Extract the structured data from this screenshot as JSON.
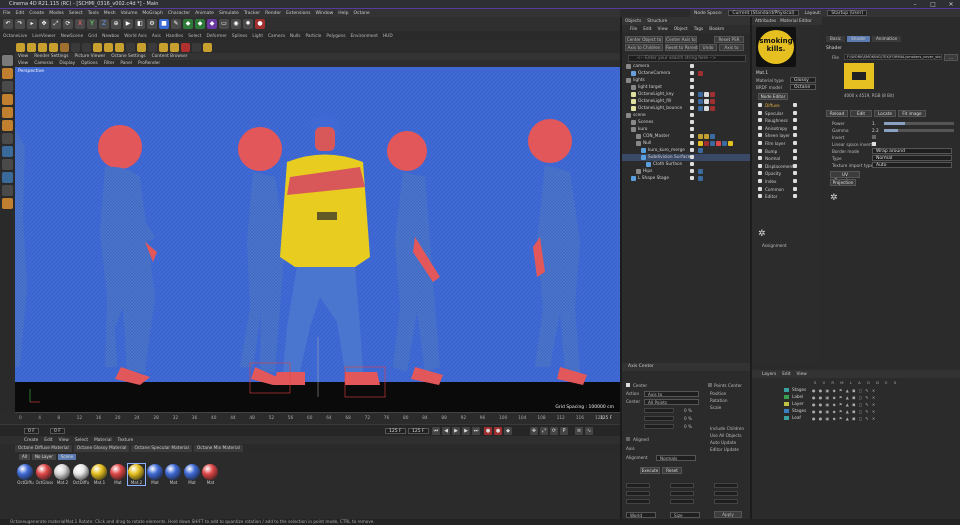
{
  "window": {
    "title": "Cinema 4D R21.115 (RC) - [SCHMI_0316_v002.c4d *] - Main"
  },
  "menu": [
    "File",
    "Edit",
    "Create",
    "Modes",
    "Select",
    "Tools",
    "Mesh",
    "Volume",
    "MoGraph",
    "Character",
    "Animate",
    "Simulate",
    "Tracker",
    "Render",
    "Extensions",
    "Window",
    "Help",
    "Octane"
  ],
  "top_right": {
    "node_space_label": "Node Space:",
    "node_space_value": "Current (Standard/Physical)",
    "layout_label": "Layout:",
    "layout_value": "Startup (User)"
  },
  "octane_toolbar": [
    "OctaneLive",
    "LiveViewer",
    "NewScene",
    "Grid",
    "Newbox",
    "World Axis",
    "Axis",
    "Handles",
    "Select",
    "Deformer",
    "Splines",
    "Light",
    "Camera",
    "Nulls",
    "Particle",
    "Polygons",
    "Environment",
    "HUD"
  ],
  "viewport": {
    "tabs": [
      "View",
      "Render Settings",
      "Picture Viewer",
      "Octane Settings",
      "Content Browser"
    ],
    "menu": [
      "View",
      "Cameras",
      "Display",
      "Options",
      "Filter",
      "Panel",
      "ProRender"
    ],
    "label": "Perspective",
    "grid_spacing": "Grid Spacing : 100000 cm"
  },
  "timeline": {
    "ticks": [
      "0",
      "4",
      "8",
      "12",
      "16",
      "20",
      "24",
      "28",
      "32",
      "36",
      "40",
      "44",
      "48",
      "52",
      "56",
      "60",
      "64",
      "68",
      "72",
      "76",
      "80",
      "84",
      "88",
      "92",
      "96",
      "100",
      "104",
      "108",
      "112",
      "116",
      "120"
    ],
    "frame_end": "125 F"
  },
  "playback": {
    "start": "0 F",
    "current": "0 F",
    "end": "125 F",
    "max": "125 F"
  },
  "material_manager": {
    "menu": [
      "Create",
      "Edit",
      "View",
      "Select",
      "Material",
      "Texture"
    ],
    "tabs": [
      "Octane Diffuse Material",
      "Octane Glossy Material",
      "Octane Specular Material",
      "Octane Mix Material"
    ],
    "filters": [
      "All",
      "No Layer",
      "Scene"
    ],
    "materials": [
      {
        "label": "OctDiffu",
        "color": "#3f6ad6"
      },
      {
        "label": "OctGloss",
        "color": "#e04848"
      },
      {
        "label": "Mat.2",
        "color": "#d8d8d8"
      },
      {
        "label": "OctDiffu",
        "color": "#e8e8e8"
      },
      {
        "label": "Mat.1",
        "color": "#e6c020"
      },
      {
        "label": "Mat",
        "color": "#e04848"
      },
      {
        "label": "Mat.2",
        "color": "#e6c020"
      },
      {
        "label": "Mat",
        "color": "#3f6ad6"
      },
      {
        "label": "Mat",
        "color": "#3f6ad6"
      },
      {
        "label": "Mat",
        "color": "#3f6ad6"
      },
      {
        "label": "Mat",
        "color": "#e04848"
      }
    ]
  },
  "status": "Octaneugenerate materialMat.1   Rotate: Click and drag to rotate elements. Hold down SHIFT to add to quantize rotation / add to the selection in point mode, CTRL to remove.",
  "objects": {
    "tabs": [
      "Objects",
      "Structure"
    ],
    "menu": [
      "File",
      "Edit",
      "View",
      "Object",
      "Tags",
      "Bookm"
    ],
    "buttons": [
      "Center Object to",
      "Center Axis to",
      "Reset PSR",
      "Axis to Children",
      "Reset to Parent",
      "Undo",
      "Axis to"
    ],
    "search_placeholder": "<-- Enter your search string here -->",
    "tree": [
      {
        "name": "camera",
        "indent": 0,
        "color": "#888"
      },
      {
        "name": "OctaneCamera",
        "indent": 1,
        "color": "#6aa0e0"
      },
      {
        "name": "lights",
        "indent": 0,
        "color": "#888"
      },
      {
        "name": "light target",
        "indent": 1,
        "color": "#888"
      },
      {
        "name": "OctaneLight_key",
        "indent": 1,
        "color": "#e0e0a0"
      },
      {
        "name": "OctaneLight_fill",
        "indent": 1,
        "color": "#e0e0a0"
      },
      {
        "name": "OctaneLight_bounce",
        "indent": 1,
        "color": "#e0e0a0"
      },
      {
        "name": "scene",
        "indent": 0,
        "color": "#888"
      },
      {
        "name": "Scenes",
        "indent": 1,
        "color": "#888"
      },
      {
        "name": "kuro",
        "indent": 1,
        "color": "#888"
      },
      {
        "name": "CON_Master",
        "indent": 2,
        "color": "#888"
      },
      {
        "name": "Null",
        "indent": 2,
        "color": "#888"
      },
      {
        "name": "kuro_kuro_merge",
        "indent": 3,
        "color": "#5aa0e0"
      },
      {
        "name": "Subdivision Surface",
        "indent": 3,
        "color": "#5aa0e0"
      },
      {
        "name": "Cloth Surface",
        "indent": 4,
        "color": "#5aa0e0"
      },
      {
        "name": "Hips",
        "indent": 2,
        "color": "#888"
      },
      {
        "name": "L Shape Stage",
        "indent": 1,
        "color": "#5aa0e0"
      }
    ]
  },
  "attributes": {
    "header": "Axis Center",
    "center_label": "Center",
    "points_center": "Points Center",
    "action_label": "Action",
    "action_value": "Axis to",
    "center_row_label": "Center",
    "center_row_value": "All Points",
    "pct_values": [
      "0 %",
      "0 %",
      "0 %"
    ],
    "options": [
      "Position",
      "Rotation",
      "Scale",
      "Include Children",
      "Use All Objects",
      "Auto Update",
      "Editor Update"
    ],
    "aligned": "Aligned",
    "axis_label": "Axis",
    "alignment_label": "Alignment",
    "alignment_value": "Normals",
    "execute": "Execute",
    "reset": "Reset",
    "apply": "Apply",
    "world_label": "World",
    "size_label": "Size",
    "scale_label": "Scale"
  },
  "material_editor": {
    "tabs": [
      "Attributes",
      "Material Editor"
    ],
    "preview_text_line1": "smoking",
    "preview_text_line2": "kills.",
    "mat_name": "Mat.1",
    "channels": [
      {
        "name": "Diffuse",
        "on": true
      },
      {
        "name": "Specular",
        "on": true
      },
      {
        "name": "Roughness",
        "on": true
      },
      {
        "name": "Anisotropy",
        "on": true
      },
      {
        "name": "Sheen layer",
        "on": true
      },
      {
        "name": "Film layer",
        "on": true
      },
      {
        "name": "Bump",
        "on": true
      },
      {
        "name": "Normal",
        "on": true
      },
      {
        "name": "Displacement",
        "on": true
      },
      {
        "name": "Opacity",
        "on": true
      },
      {
        "name": "Index",
        "on": true
      },
      {
        "name": "Common",
        "on": true
      },
      {
        "name": "Editor",
        "on": true
      }
    ],
    "node_editor": "Node Editor",
    "mat_type_label": "Material type",
    "mat_type_value": "Glossy",
    "brdf_label": "BRDF model",
    "brdf_value": "Octane",
    "assignment": "Assignment",
    "right_tabs": [
      "Basic",
      "Shader",
      "Animation"
    ],
    "shader_label": "Shader",
    "file_label": "File",
    "file_path": "F:\\WORK\\SMOKING\\TEX\\FORMAL\\smokers_never_sto",
    "file_info": "4000 x 4519, RGB (8 Bit)",
    "buttons": [
      "Reload",
      "Edit",
      "Locate",
      "Fit image"
    ],
    "power_label": "Power",
    "power_value": "1.",
    "gamma_label": "Gamma",
    "gamma_value": "2.2",
    "invert_label": "Invert",
    "linear_label": "Linear space invert",
    "border_label": "Border mode",
    "border_value": "Wrap around",
    "type_label": "Type",
    "type_value": "Normal",
    "texproj_label": "Texture import type",
    "texproj_value": "Auto",
    "uv_transform": "UV Transform",
    "projection": "Projection"
  },
  "layers": {
    "menu": [
      "Layers",
      "Edit",
      "View"
    ],
    "columns": [
      "S",
      "V",
      "R",
      "M",
      "L",
      "A",
      "G",
      "D",
      "E",
      "X"
    ],
    "items": [
      {
        "name": "Stages",
        "color": "#3aa0a0"
      },
      {
        "name": "Label",
        "color": "#3aa050"
      },
      {
        "name": "Layer",
        "color": "#c0c040"
      },
      {
        "name": "Stages",
        "color": "#3a80c0"
      },
      {
        "name": "Leaf",
        "color": "#3aa0a0"
      }
    ]
  }
}
